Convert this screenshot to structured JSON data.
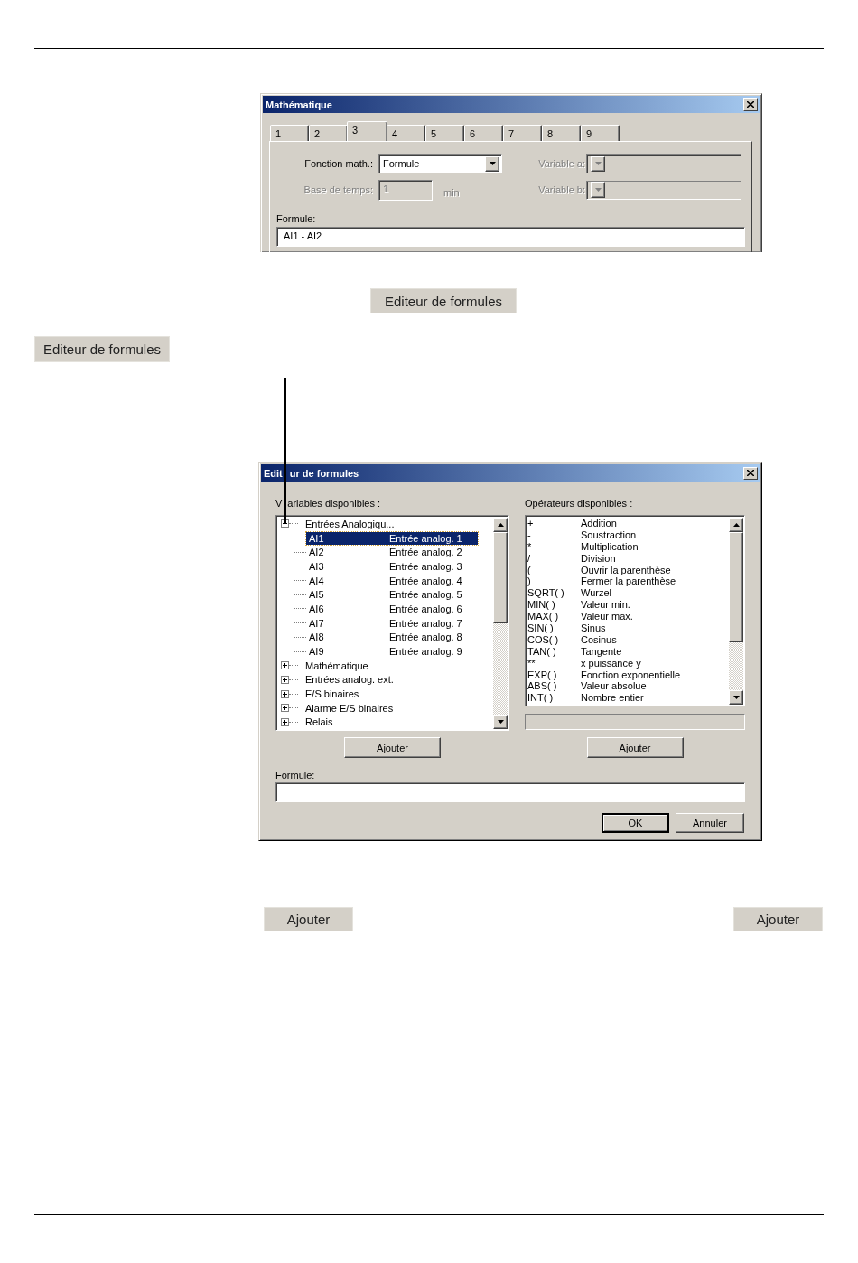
{
  "math_dialog": {
    "title": "Mathématique",
    "tabs": [
      {
        "label": "1",
        "selected": false
      },
      {
        "label": "2",
        "selected": false
      },
      {
        "label": "3",
        "selected": true
      },
      {
        "label": "4",
        "selected": false
      },
      {
        "label": "5",
        "selected": false
      },
      {
        "label": "6",
        "selected": false
      },
      {
        "label": "7",
        "selected": false
      },
      {
        "label": "8",
        "selected": false
      },
      {
        "label": "9",
        "selected": false
      }
    ],
    "function": {
      "label": "Fonction math.:",
      "value": "Formule",
      "disabled": false
    },
    "time_base": {
      "label": "Base de temps:",
      "value": "1",
      "unit": "min",
      "disabled": true
    },
    "variable_a": {
      "label": "Variable a:",
      "disabled": true
    },
    "variable_b": {
      "label": "Variable b:",
      "disabled": true
    },
    "formula": {
      "label": "Formule:",
      "value": "AI1 - AI2"
    }
  },
  "editor_button_center": {
    "label": "Editeur de formules"
  },
  "editor_button_left": {
    "label": "Editeur de formules"
  },
  "formula_editor": {
    "title_parts": [
      "Edit",
      "ur de formules"
    ],
    "variables_label_parts": [
      "V",
      "ariables disponibles :"
    ],
    "variables_tree": [
      {
        "label": "Entrées Analogiqu...",
        "expanded": true,
        "children": [
          {
            "name": "AI1",
            "description": "Entrée analog. 1",
            "selected": true
          },
          {
            "name": "AI2",
            "description": "Entrée analog. 2",
            "selected": false
          },
          {
            "name": "AI3",
            "description": "Entrée analog. 3",
            "selected": false
          },
          {
            "name": "AI4",
            "description": "Entrée analog. 4",
            "selected": false
          },
          {
            "name": "AI5",
            "description": "Entrée analog. 5",
            "selected": false
          },
          {
            "name": "AI6",
            "description": "Entrée analog. 6",
            "selected": false
          },
          {
            "name": "AI7",
            "description": "Entrée analog. 7",
            "selected": false
          },
          {
            "name": "AI8",
            "description": "Entrée analog. 8",
            "selected": false
          },
          {
            "name": "AI9",
            "description": "Entrée analog. 9",
            "selected": false
          }
        ]
      },
      {
        "label": "Mathématique",
        "expanded": false
      },
      {
        "label": "Entrées analog. ext.",
        "expanded": false
      },
      {
        "label": "E/S binaires",
        "expanded": false
      },
      {
        "label": "Alarme E/S binaires",
        "expanded": false
      },
      {
        "label": "Relais",
        "expanded": false
      }
    ],
    "operators_label": "Opérateurs disponibles :",
    "operators": [
      {
        "symbol": "+",
        "description": "Addition"
      },
      {
        "symbol": "-",
        "description": "Soustraction"
      },
      {
        "symbol": "*",
        "description": "Multiplication"
      },
      {
        "symbol": "/",
        "description": "Division"
      },
      {
        "symbol": "(",
        "description": "Ouvrir la parenthèse"
      },
      {
        "symbol": ")",
        "description": "Fermer la parenthèse"
      },
      {
        "symbol": "SQRT( )",
        "description": "Wurzel"
      },
      {
        "symbol": "MIN( )",
        "description": "Valeur min."
      },
      {
        "symbol": "MAX( )",
        "description": "Valeur max."
      },
      {
        "symbol": "SIN( )",
        "description": "Sinus"
      },
      {
        "symbol": "COS( )",
        "description": "Cosinus"
      },
      {
        "symbol": "TAN( )",
        "description": "Tangente"
      },
      {
        "symbol": "**",
        "description": "x puissance y"
      },
      {
        "symbol": "EXP( )",
        "description": "Fonction exponentielle"
      },
      {
        "symbol": "ABS( )",
        "description": "Valeur absolue"
      },
      {
        "symbol": "INT( )",
        "description": "Nombre entier"
      }
    ],
    "add_variable_button": "Ajouter",
    "add_operator_button": "Ajouter",
    "formula_label": "Formule:",
    "ok_button": "OK",
    "cancel_button": "Annuler"
  },
  "bottom_buttons": [
    "Ajouter",
    "Ajouter"
  ]
}
